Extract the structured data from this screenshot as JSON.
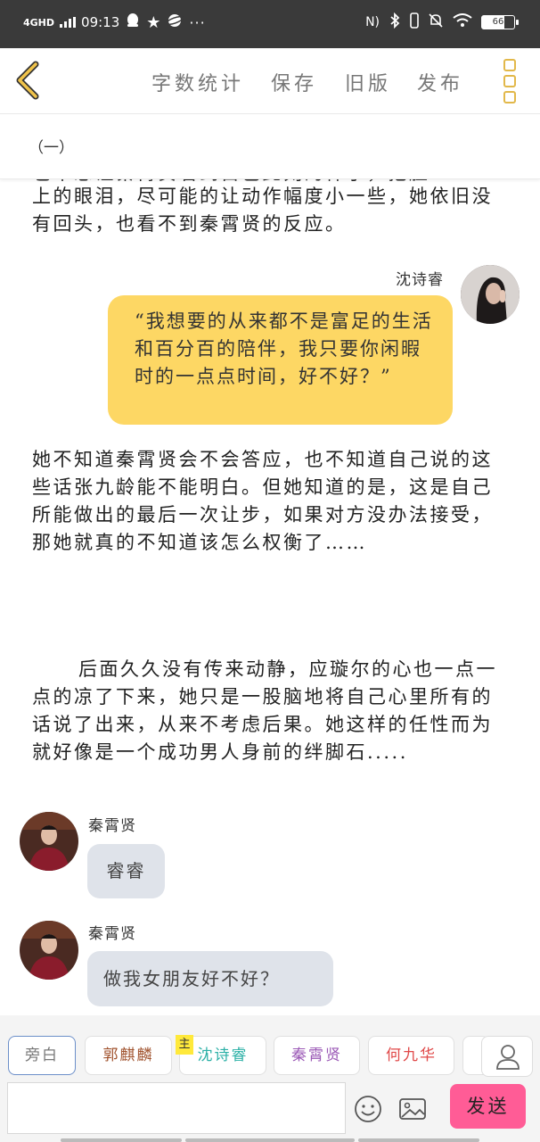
{
  "status_bar": {
    "network": "4GHD",
    "time": "09:13",
    "left_icons": [
      "qq-icon",
      "star-icon",
      "planet-icon",
      "more-dots"
    ],
    "battery": "66"
  },
  "toolbar": {
    "word_count_label": "字数统计",
    "save_label": "保存",
    "old_version_label": "旧版",
    "publish_label": "发布"
  },
  "chapter": {
    "title": "（一）"
  },
  "content": {
    "cut_line": "也不想让秦霄贤看到自己此刻的样子，把脸",
    "para1": "上的眼泪，尽可能的让动作幅度小一些，她依旧没有回头，也看不到秦霄贤的反应。",
    "dialog1": {
      "speaker": "沈诗睿",
      "text": "“我想要的从来都不是富足的生活和百分百的陪伴，我只要你闲暇时的一点点时间，好不好？”"
    },
    "para2": "她不知道秦霄贤会不会答应，也不知道自己说的这些话张九龄能不能明白。但她知道的是，这是自己所能做出的最后一次让步，如果对方没办法接受，那她就真的不知道该怎么权衡了……",
    "para3": "后面久久没有传来动静，应璇尔的心也一点一点的凉了下来，她只是一股脑地将自己心里所有的话说了出来，从来不考虑后果。她这样的任性而为就好像是一个成功男人身前的绊脚石.....",
    "dialog2": {
      "speaker": "秦霄贤",
      "text": "睿睿"
    },
    "dialog3": {
      "speaker": "秦霄贤",
      "text": "做我女朋友好不好？"
    }
  },
  "roles": {
    "host_badge": "主",
    "tabs": [
      {
        "label": "旁白",
        "color": "#777777"
      },
      {
        "label": "郭麒麟",
        "color": "#a0522d"
      },
      {
        "label": "沈诗睿",
        "color": "#2bb0a6"
      },
      {
        "label": "秦霄贤",
        "color": "#9b59b6"
      },
      {
        "label": "何九华",
        "color": "#e04848"
      }
    ]
  },
  "input": {
    "value": "",
    "placeholder": ""
  },
  "send_label": "发送",
  "colors": {
    "accent_yellow": "#fdd764",
    "send_pink": "#ff5c96",
    "menu_gold": "#e2b84a"
  }
}
